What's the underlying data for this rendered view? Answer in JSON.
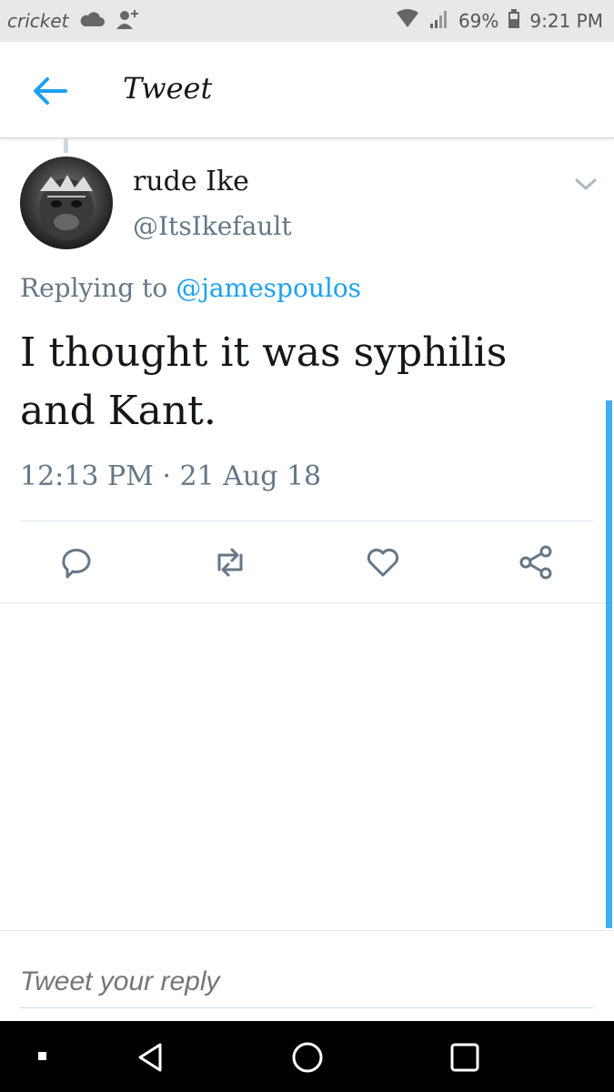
{
  "status_bar": {
    "carrier": "cricket",
    "battery": "69%",
    "time": "9:21 PM",
    "icons": [
      "cloud-icon",
      "add-person-icon",
      "wifi-icon",
      "signal-icon",
      "battery-icon"
    ]
  },
  "header": {
    "title": "Tweet",
    "back_icon": "arrow-left-icon"
  },
  "tweet": {
    "display_name": "rude Ike",
    "handle": "@ItsIkefault",
    "replying_prefix": "Replying to",
    "replying_to": "@jamespoulos",
    "text": "I thought it was syphilis and Kant.",
    "timestamp": "12:13 PM · 21 Aug 18",
    "actions": [
      "reply-icon",
      "retweet-icon",
      "like-icon",
      "share-icon"
    ]
  },
  "reply": {
    "placeholder": "Tweet your reply"
  },
  "nav": {
    "buttons": [
      "recent-apps",
      "back",
      "home",
      "overview"
    ]
  },
  "colors": {
    "accent": "#1da1f2",
    "text": "#14171a",
    "muted": "#657786"
  }
}
